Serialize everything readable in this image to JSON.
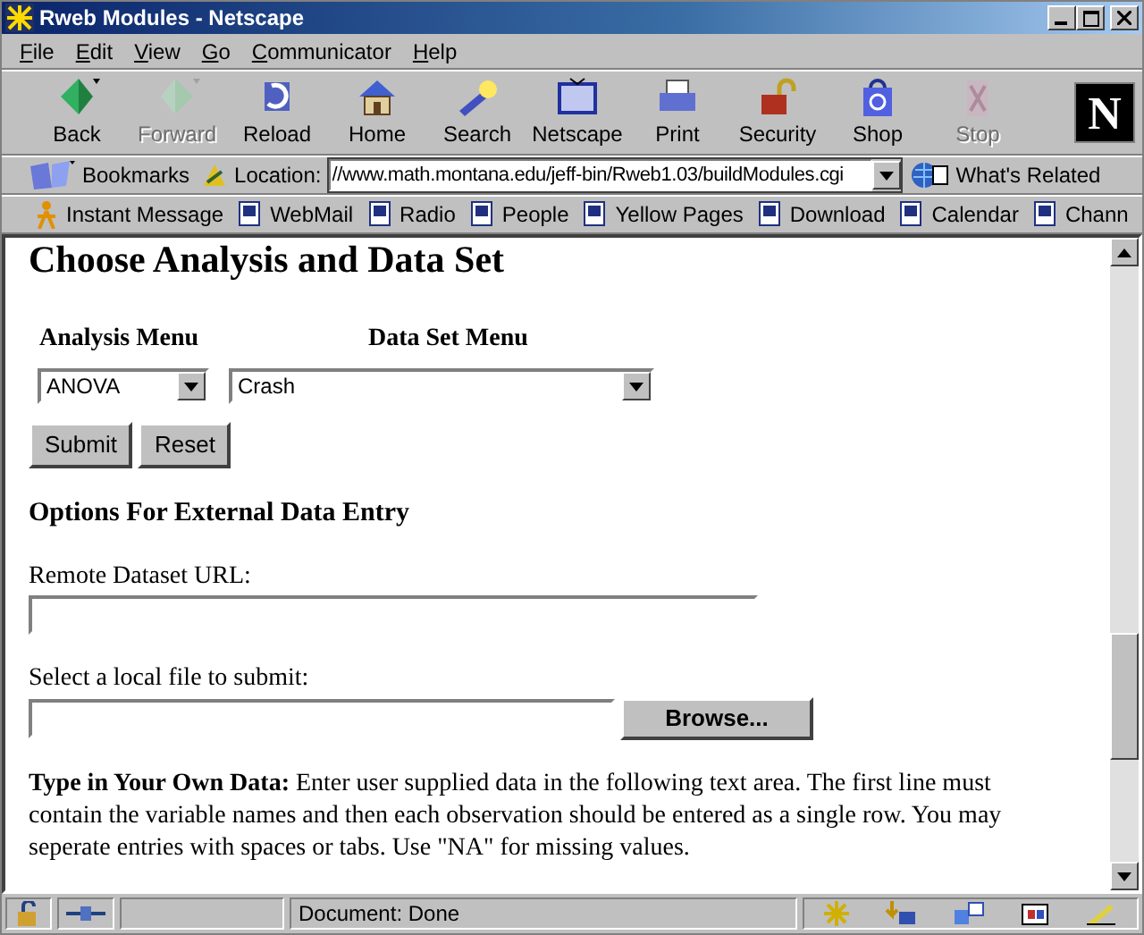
{
  "window": {
    "title": "Rweb Modules - Netscape"
  },
  "menu": [
    "File",
    "Edit",
    "View",
    "Go",
    "Communicator",
    "Help"
  ],
  "toolbar": [
    {
      "label": "Back",
      "disabled": false
    },
    {
      "label": "Forward",
      "disabled": true
    },
    {
      "label": "Reload",
      "disabled": false
    },
    {
      "label": "Home",
      "disabled": false
    },
    {
      "label": "Search",
      "disabled": false
    },
    {
      "label": "Netscape",
      "disabled": false
    },
    {
      "label": "Print",
      "disabled": false
    },
    {
      "label": "Security",
      "disabled": false
    },
    {
      "label": "Shop",
      "disabled": false
    },
    {
      "label": "Stop",
      "disabled": true
    }
  ],
  "logo": "N",
  "location_bar": {
    "bookmarks": "Bookmarks",
    "location_label": "Location:",
    "url": "//www.math.montana.edu/jeff-bin/Rweb1.03/buildModules.cgi",
    "related": "What's Related"
  },
  "personal_bar": [
    "Instant Message",
    "WebMail",
    "Radio",
    "People",
    "Yellow Pages",
    "Download",
    "Calendar",
    "Chann"
  ],
  "page": {
    "heading": "Choose Analysis and Data Set",
    "analysis_label": "Analysis Menu",
    "dataset_label": "Data Set Menu",
    "analysis_value": "ANOVA",
    "dataset_value": "Crash",
    "buttons": [
      "Submit",
      "Reset"
    ],
    "options_heading": "Options For External Data Entry",
    "url_label": "Remote Dataset URL:",
    "file_label": "Select a local file to submit:",
    "browse": "Browse...",
    "paragraph": "**Type in Your Own Data:** Enter user supplied data in the following text area. The first line must contain the variable names and then each observation should be entered as a single row. You may seperate entries with spaces or tabs. Use \"NA\" for missing values."
  },
  "status_bar": {
    "text": "Document: Done"
  }
}
